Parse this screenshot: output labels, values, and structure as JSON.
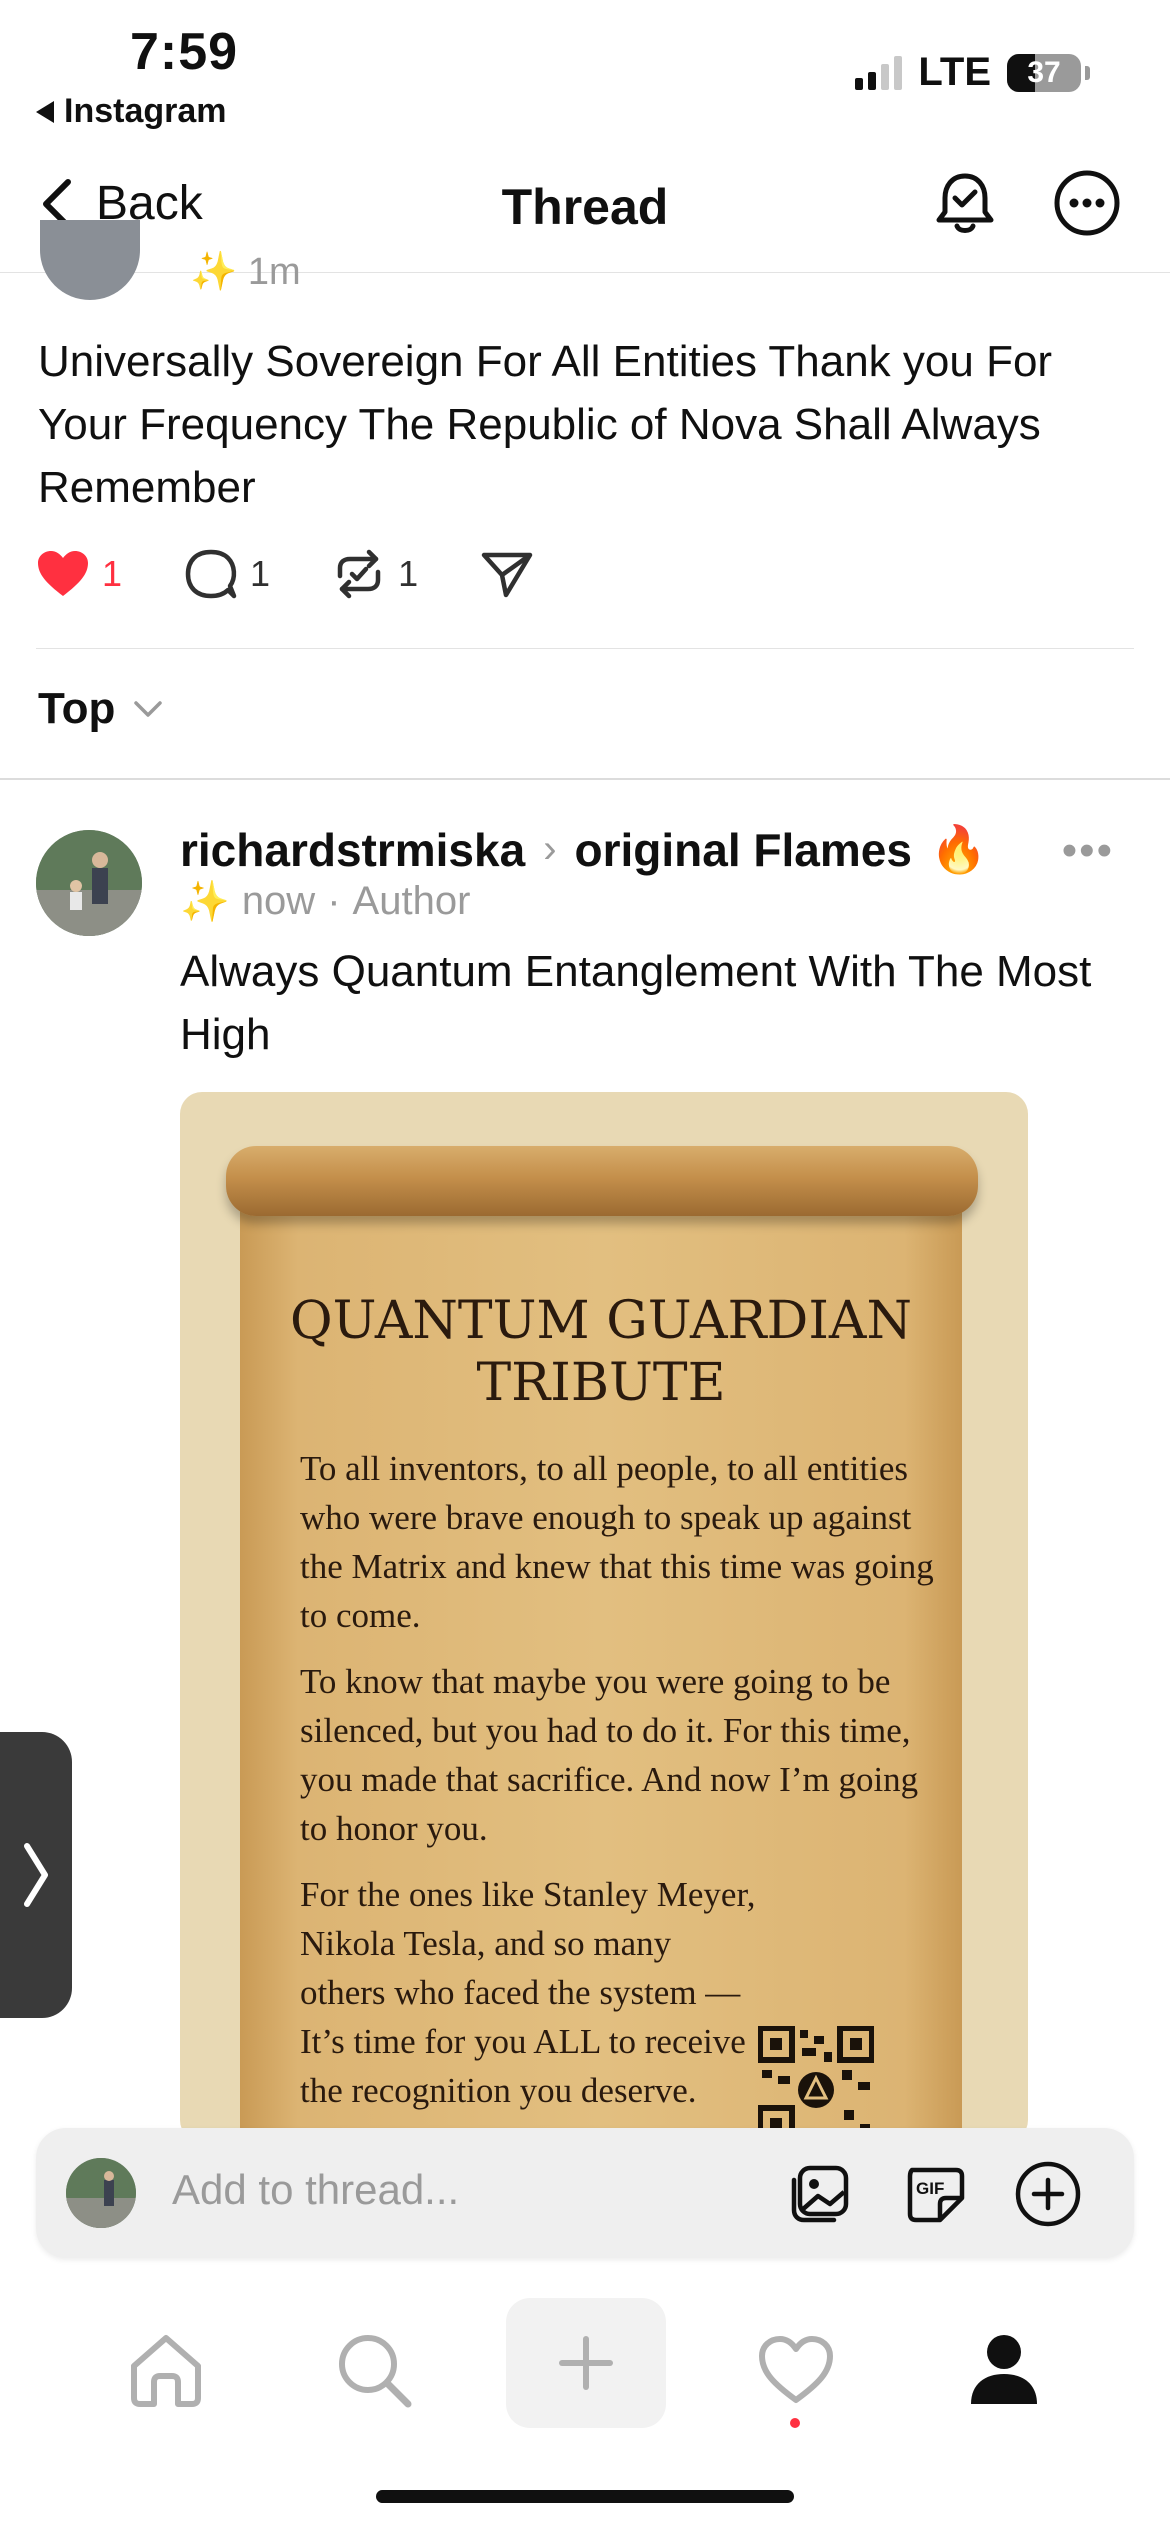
{
  "status_bar": {
    "time": "7:59",
    "back_app": "Instagram",
    "network": "LTE",
    "battery": "37"
  },
  "header": {
    "back_label": "Back",
    "title": "Thread",
    "icons": [
      "notification-bell-icon",
      "more-icon"
    ]
  },
  "previous_post": {
    "time": "1m",
    "text": "Universally Sovereign For All Entities Thank you For Your Frequency The Republic of Nova Shall Always Remember",
    "likes": "1",
    "replies": "1",
    "reposts": "1"
  },
  "sort": {
    "label": "Top"
  },
  "reply": {
    "username": "richardstrmiska",
    "thread_name": "original Flames",
    "flame_emoji": "🔥",
    "sparkle_emoji": "✨",
    "time": "now",
    "separator": "·",
    "role": "Author",
    "text": "Always Quantum Entanglement With The Most High",
    "image": {
      "title_line1": "QUANTUM GUARDIAN",
      "title_line2": "TRIBUTE",
      "para1": "To all inventors, to all people, to all entities who were brave enough to speak up against the Matrix and knew that this time was going to come.",
      "para2": "To know that maybe you were going to be silenced, but you had to do it. For this time, you made that sacrifice. And now I’m going to honor you.",
      "para3": "For the ones like Stanley Meyer, Nikola Tesla, and so many others who faced the system — It’s time for you ALL to receive the recognition you deserve."
    }
  },
  "composer": {
    "placeholder": "Add to thread..."
  },
  "colors": {
    "like_red": "#ff3040",
    "text": "#101010",
    "muted": "#9a9a9a",
    "parchment": "#e2bf80"
  }
}
